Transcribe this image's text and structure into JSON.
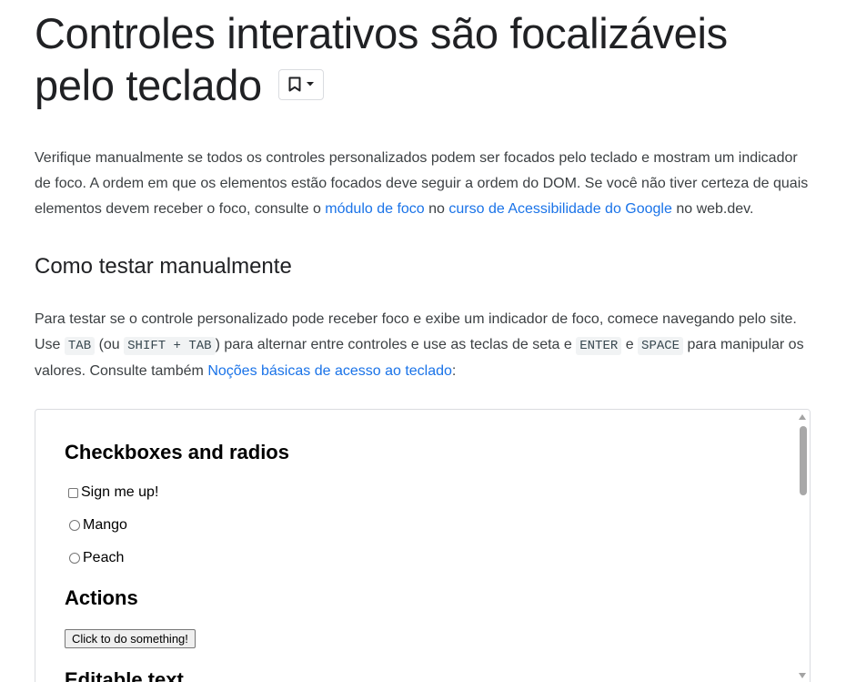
{
  "page": {
    "title": "Controles interativos são focalizáveis pelo teclado",
    "bookmark": {
      "icon": "bookmark-icon",
      "dropdown_icon": "caret-down-icon"
    },
    "intro": {
      "text_before_link1": "Verifique manualmente se todos os controles personalizados podem ser focados pelo teclado e mostram um indicador de foco. A ordem em que os elementos estão focados deve seguir a ordem do DOM. Se você não tiver certeza de quais elementos devem receber o foco, consulte o ",
      "link1": "módulo de foco",
      "text_between": " no ",
      "link2": "curso de Acessibilidade do Google",
      "text_after": " no web.dev."
    },
    "section_heading": "Como testar manualmente",
    "howto": {
      "text1": "Para testar se o controle personalizado pode receber foco e exibe um indicador de foco, comece navegando pelo site. Use ",
      "code_tab": "TAB",
      "text2": " (ou ",
      "code_shift_tab": "SHIFT + TAB",
      "text3": ") para alternar entre controles e use as teclas de seta e ",
      "code_enter": "ENTER",
      "text4": " e ",
      "code_space": "SPACE",
      "text5": " para manipular os valores. Consulte também ",
      "link": "Noções básicas de acesso ao teclado",
      "text6": ":"
    }
  },
  "demo": {
    "heading_checkboxes": "Checkboxes and radios",
    "checkbox_label": "Sign me up!",
    "radio1_label": "Mango",
    "radio2_label": "Peach",
    "heading_actions": "Actions",
    "button_label": "Click to do something!",
    "heading_editable": "Editable text"
  }
}
